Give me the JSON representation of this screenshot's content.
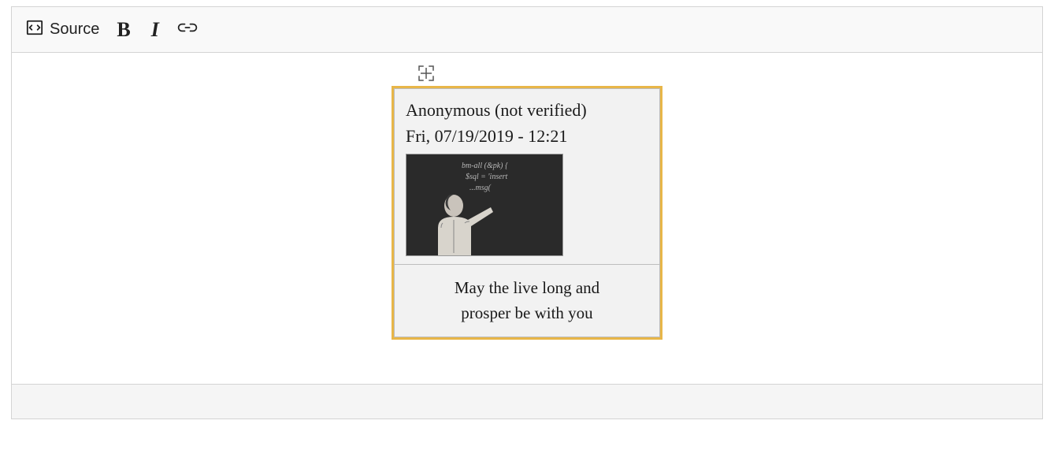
{
  "toolbar": {
    "source_label": "Source",
    "bold_glyph": "B",
    "italic_glyph": "I"
  },
  "block": {
    "author": "Anonymous (not verified)",
    "date": "Fri, 07/19/2019 - 12:21",
    "caption_line1": "May the live long and",
    "caption_line2": "prosper be with you"
  }
}
